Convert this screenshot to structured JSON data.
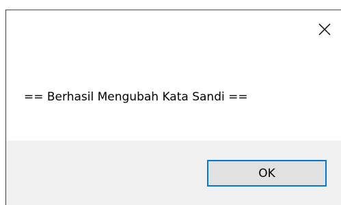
{
  "dialog": {
    "message": "== Berhasil Mengubah Kata Sandi ==",
    "close_icon": "close-icon",
    "ok_label": "OK",
    "colors": {
      "background": "#ffffff",
      "footer": "#f0f0f0",
      "button_face": "#e1e1e1",
      "button_focus_border": "#0078d7"
    }
  }
}
